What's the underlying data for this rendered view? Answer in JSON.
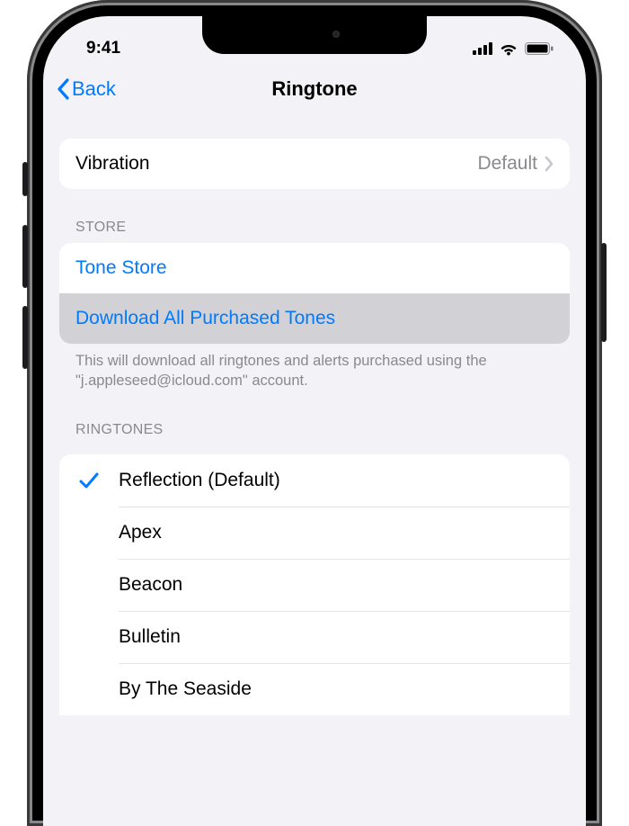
{
  "status": {
    "time": "9:41"
  },
  "nav": {
    "back": "Back",
    "title": "Ringtone"
  },
  "vibration": {
    "label": "Vibration",
    "value": "Default"
  },
  "store": {
    "header": "STORE",
    "tone_store": "Tone Store",
    "download_all": "Download All Purchased Tones",
    "footer": "This will download all ringtones and alerts purchased using the \"j.appleseed@icloud.com\" account."
  },
  "ringtones": {
    "header": "RINGTONES",
    "items": [
      {
        "label": "Reflection (Default)",
        "selected": true
      },
      {
        "label": "Apex",
        "selected": false
      },
      {
        "label": "Beacon",
        "selected": false
      },
      {
        "label": "Bulletin",
        "selected": false
      },
      {
        "label": "By The Seaside",
        "selected": false
      }
    ]
  }
}
